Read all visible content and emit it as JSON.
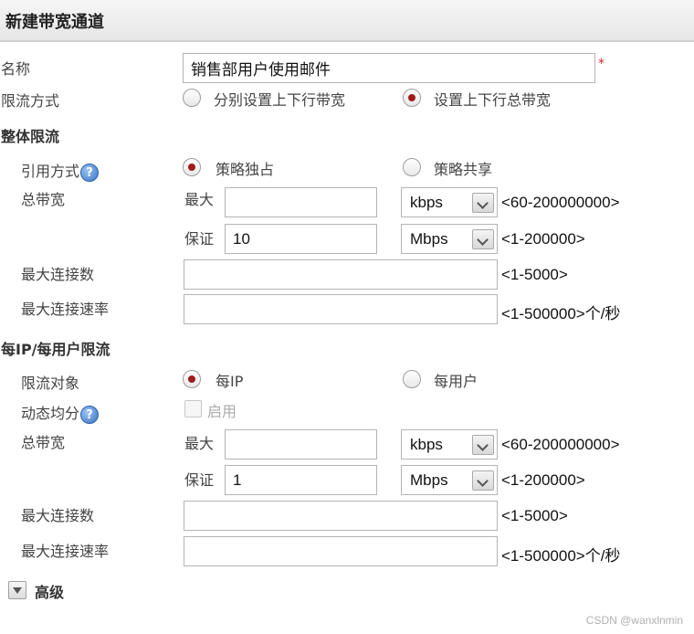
{
  "window": {
    "title": "新建带宽通道"
  },
  "name_row": {
    "label": "名称",
    "value": "销售部用户使用邮件",
    "required": "*"
  },
  "limit_mode": {
    "label": "限流方式",
    "options": [
      "分别设置上下行带宽",
      "设置上下行总带宽"
    ],
    "selected": 1
  },
  "overall": {
    "section_title": "整体限流",
    "ref_mode": {
      "label": "引用方式",
      "options": [
        "策略独占",
        "策略共享"
      ],
      "selected": 0
    },
    "bandwidth_label": "总带宽",
    "max": {
      "label": "最大",
      "value": "",
      "unit": "kbps",
      "range": "<60-200000000>"
    },
    "guarantee": {
      "label": "保证",
      "value": "10",
      "unit": "Mbps",
      "range": "<1-200000>"
    },
    "max_conn": {
      "label": "最大连接数",
      "value": "",
      "range": "<1-5000>"
    },
    "max_conn_rate": {
      "label": "最大连接速率",
      "value": "",
      "range": "<1-500000>个/秒"
    }
  },
  "per_ip": {
    "section_title": "每IP/每用户限流",
    "target": {
      "label": "限流对象",
      "options": [
        "每IP",
        "每用户"
      ],
      "selected": 0
    },
    "dynamic": {
      "label": "动态均分",
      "checkbox_label": "启用",
      "checked": false
    },
    "bandwidth_label": "总带宽",
    "max": {
      "label": "最大",
      "value": "",
      "unit": "kbps",
      "range": "<60-200000000>"
    },
    "guarantee": {
      "label": "保证",
      "value": "1",
      "unit": "Mbps",
      "range": "<1-200000>"
    },
    "max_conn": {
      "label": "最大连接数",
      "value": "",
      "range": "<1-5000>"
    },
    "max_conn_rate": {
      "label": "最大连接速率",
      "value": "",
      "range": "<1-500000>个/秒"
    }
  },
  "advanced": {
    "label": "高级"
  },
  "help_glyph": "?",
  "icons": {
    "help": "help-icon",
    "expand": "triangle-down-icon"
  },
  "colors": {
    "radio_dot": "#a11a1a",
    "required": "#d9282f",
    "help": "#3a74c4"
  },
  "watermark": "CSDN @wanxlnmin"
}
